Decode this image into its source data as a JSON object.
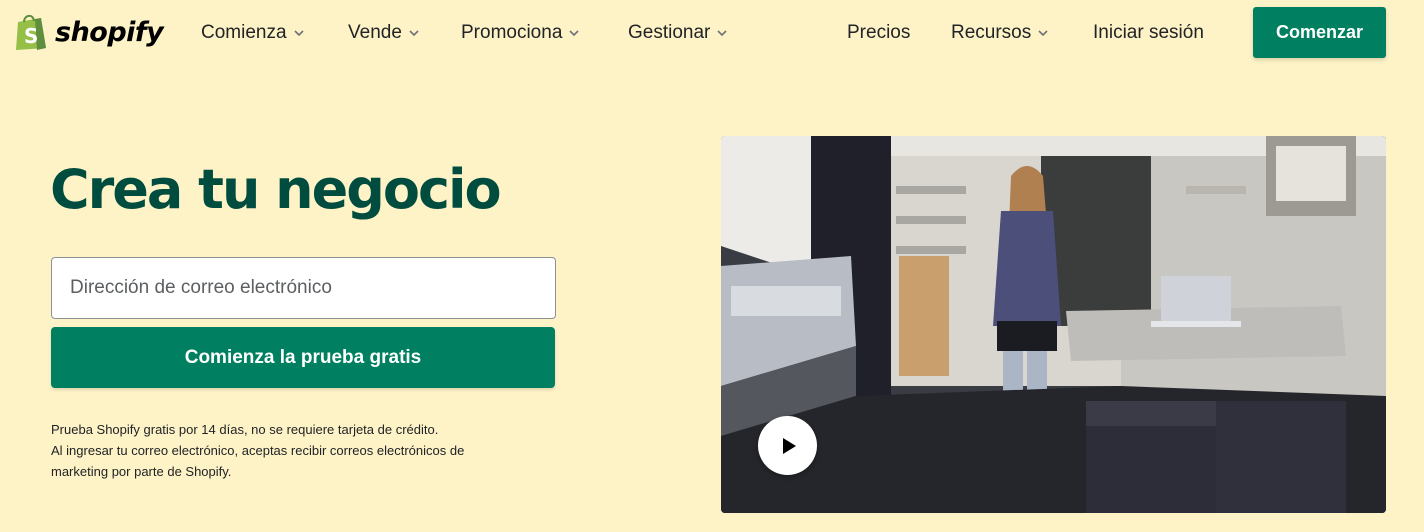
{
  "brand": {
    "name": "shopify",
    "green": "#008060",
    "dark_green": "#004c3f",
    "background": "#fef3c7"
  },
  "nav": {
    "items": [
      {
        "label": "Comienza",
        "dropdown": true
      },
      {
        "label": "Vende",
        "dropdown": true
      },
      {
        "label": "Promociona",
        "dropdown": true
      },
      {
        "label": "Gestionar",
        "dropdown": true
      }
    ],
    "right_items": [
      {
        "label": "Precios",
        "dropdown": false
      },
      {
        "label": "Recursos",
        "dropdown": true
      },
      {
        "label": "Iniciar sesión",
        "dropdown": false
      }
    ],
    "cta_label": "Comenzar"
  },
  "hero": {
    "title": "Crea tu negocio",
    "email_placeholder": "Dirección de correo electrónico",
    "email_value": "",
    "button_label": "Comienza la prueba gratis",
    "disclaimer_line1": "Prueba Shopify gratis por 14 días, no se requiere tarjeta de crédito.",
    "disclaimer_line2": "Al ingresar tu correo electrónico, aceptas recibir correos electrónicos de",
    "disclaimer_line3": "marketing por parte de Shopify."
  },
  "video": {
    "icon": "play-icon"
  }
}
